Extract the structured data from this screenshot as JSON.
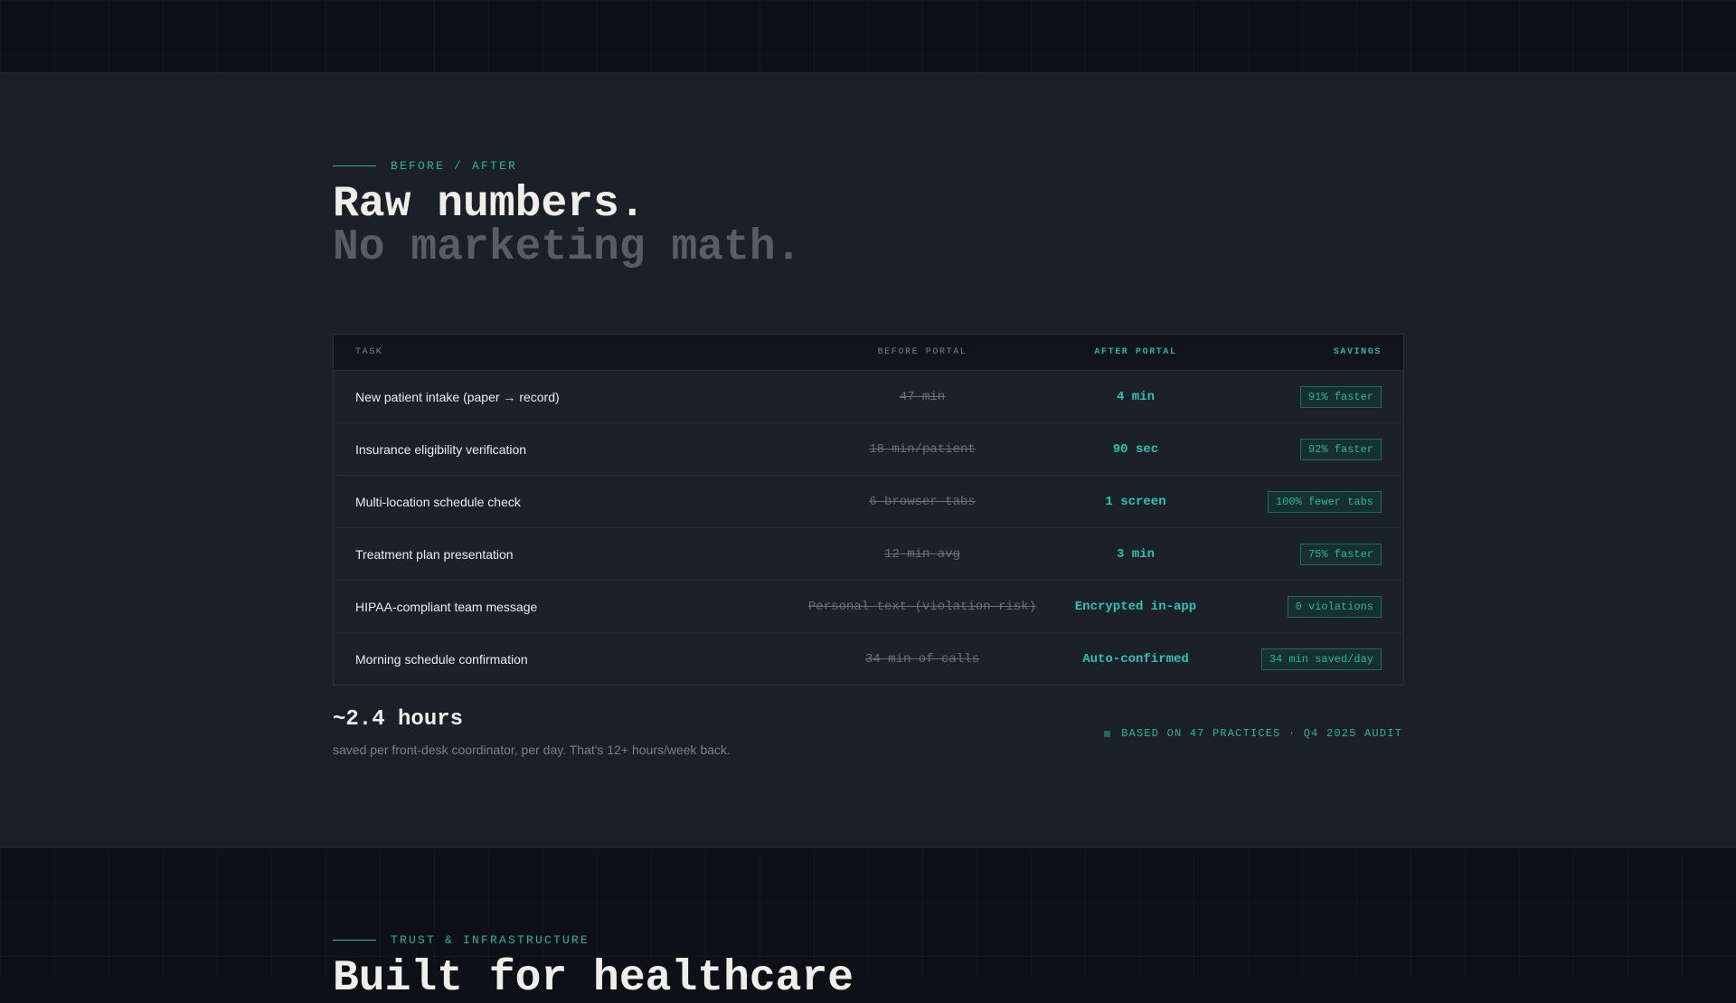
{
  "before_after": {
    "eyebrow": "BEFORE / AFTER",
    "headline_line1": "Raw numbers.",
    "headline_line2": "No marketing math.",
    "table": {
      "headers": {
        "task": "TASK",
        "before": "BEFORE PORTAL",
        "after": "AFTER PORTAL",
        "savings": "SAVINGS"
      },
      "rows": [
        {
          "task": "New patient intake (paper → record)",
          "before": "47 min",
          "after": "4 min",
          "savings": "91% faster"
        },
        {
          "task": "Insurance eligibility verification",
          "before": "18 min/patient",
          "after": "90 sec",
          "savings": "92% faster"
        },
        {
          "task": "Multi-location schedule check",
          "before": "6 browser tabs",
          "after": "1 screen",
          "savings": "100% fewer tabs"
        },
        {
          "task": "Treatment plan presentation",
          "before": "12 min avg",
          "after": "3 min",
          "savings": "75% faster"
        },
        {
          "task": "HIPAA-compliant team message",
          "before": "Personal text (violation risk)",
          "after": "Encrypted in-app",
          "savings": "0 violations"
        },
        {
          "task": "Morning schedule confirmation",
          "before": "34 min of calls",
          "after": "Auto-confirmed",
          "savings": "34 min saved/day"
        }
      ]
    },
    "total_value": "~2.4 hours",
    "total_caption": "saved per front-desk coordinator, per day. That's 12+ hours/week back.",
    "source_note": "BASED ON 47 PRACTICES · Q4 2025 AUDIT"
  },
  "trust": {
    "eyebrow": "TRUST & INFRASTRUCTURE",
    "headline": "Built for healthcare"
  },
  "colors": {
    "accent": "#2bb3a3",
    "background": "#1b1f27",
    "dark": "#0d1017"
  }
}
